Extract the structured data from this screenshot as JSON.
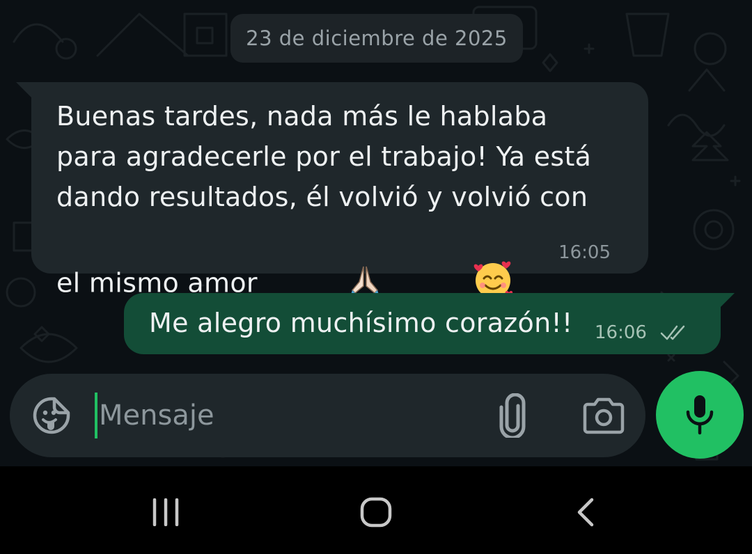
{
  "date_separator": "23 de diciembre de 2025",
  "messages": [
    {
      "direction": "incoming",
      "text": "Buenas tardes, nada más le hablaba para agradecerle por el trabajo! Ya está dando resultados, él volvió y volvió con el mismo amor",
      "emojis": [
        "🙏",
        "🥰"
      ],
      "time": "16:05"
    },
    {
      "direction": "outgoing",
      "text": "Me alegro muchísimo corazón!!",
      "time": "16:06",
      "status_icon": "double-check-icon"
    }
  ],
  "composer": {
    "placeholder": "Mensaje",
    "value": "",
    "icons": [
      "sticker-icon",
      "paperclip-icon",
      "camera-icon"
    ]
  },
  "mic_button": {
    "icon": "microphone-icon"
  },
  "system_nav": {
    "buttons": [
      "recent-apps-icon",
      "home-icon",
      "back-icon"
    ]
  },
  "colors": {
    "chat_background": "#0b1014",
    "incoming_bubble": "#1f272b",
    "outgoing_bubble": "#134d37",
    "accent_green": "#21c063",
    "date_chip": "#1d2327"
  }
}
